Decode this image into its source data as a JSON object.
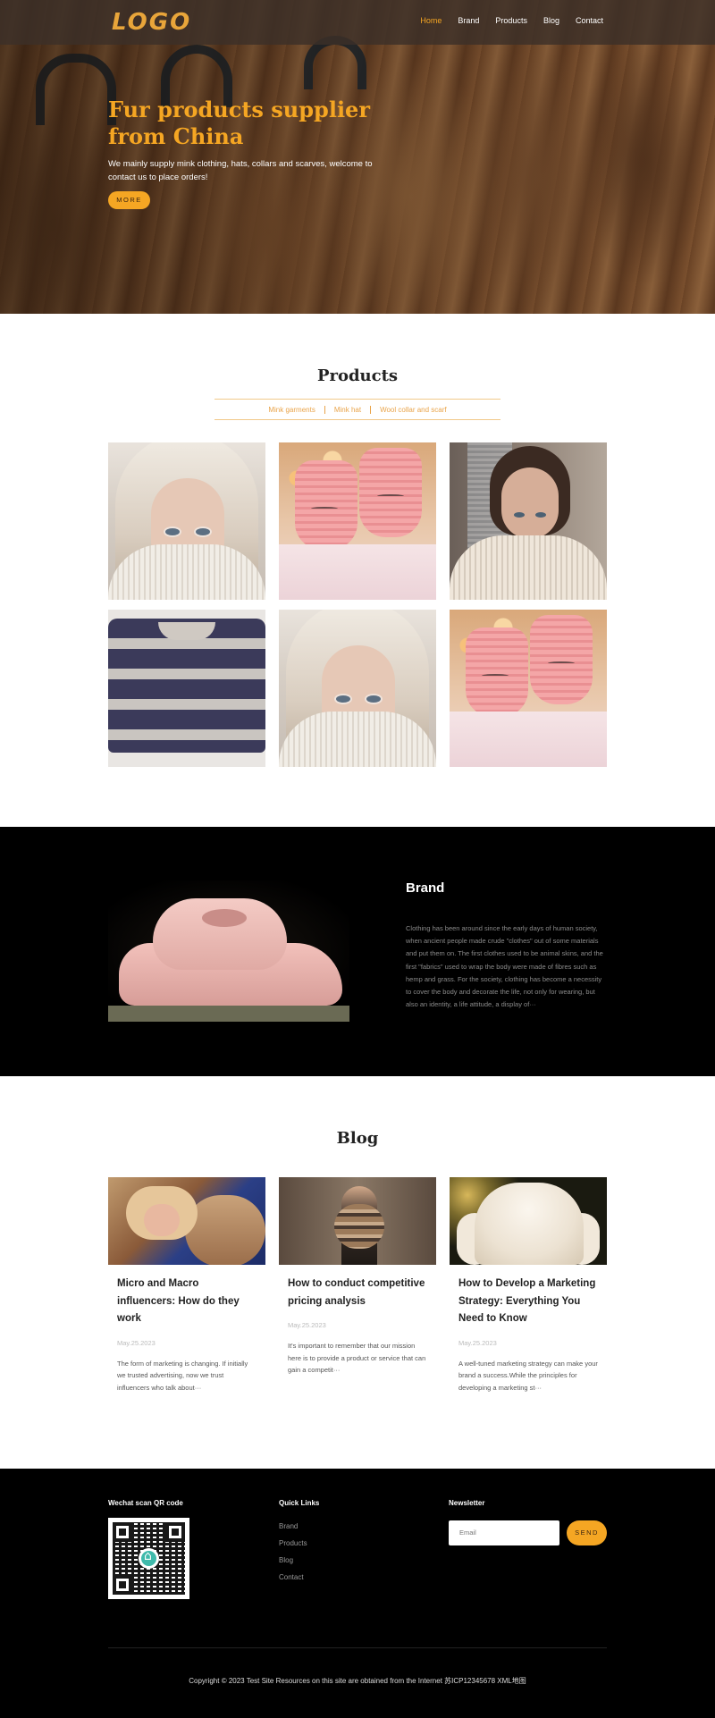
{
  "nav": {
    "logo": "LOGO",
    "links": [
      "Home",
      "Brand",
      "Products",
      "Blog",
      "Contact"
    ],
    "active": "Home"
  },
  "hero": {
    "title": "Fur products supplier from China",
    "subtitle": "We mainly supply mink clothing, hats, collars and scarves, welcome to contact us to place orders!",
    "button": "MORE"
  },
  "products": {
    "title": "Products",
    "tabs": [
      "Mink garments",
      "Mink hat",
      "Wool collar and scarf"
    ]
  },
  "brand": {
    "title": "Brand",
    "text": "Clothing has been around since the early days of human society, when ancient people made crude \"clothes\" out of some materials and put them on. The first clothes used to be animal skins, and the first \"fabrics\" used to wrap the body were made of fibres such as hemp and grass. For the society, clothing has become a necessity to cover the body and decorate the life, not only for wearing, but also an identity, a life attitude, a display of···"
  },
  "blog": {
    "title": "Blog",
    "posts": [
      {
        "title": "Micro and Macro influencers: How do they work",
        "date": "May.25.2023",
        "desc": "The form of marketing is changing. If initially we trusted advertising, now we trust influencers who talk about···"
      },
      {
        "title": "How to conduct competitive pricing analysis",
        "date": "May.25.2023",
        "desc": "It's important to remember that our mission here is to provide a product or service that can gain a competit···"
      },
      {
        "title": "How to Develop a Marketing Strategy: Everything You Need to Know",
        "date": "May.25.2023",
        "desc": "A well-tuned marketing strategy can make your brand a success.While the principles for developing a marketing st···"
      }
    ]
  },
  "footer": {
    "qr_title": "Wechat scan QR code",
    "links_title": "Quick Links",
    "links": [
      "Brand",
      "Products",
      "Blog",
      "Contact"
    ],
    "newsletter_title": "Newsletter",
    "email_placeholder": "Email",
    "send_label": "SEND",
    "copyright": "Copyright © 2023 Test Site Resources on this site are obtained from the Internet 苏ICP12345678 XML地图"
  },
  "colors": {
    "accent": "#f5a623",
    "dark": "#000000"
  }
}
